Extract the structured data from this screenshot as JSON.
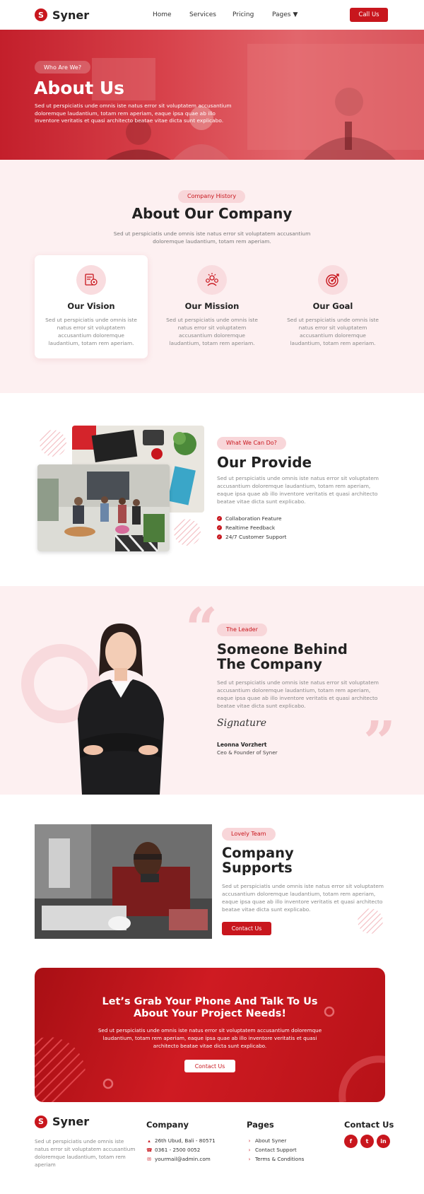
{
  "brand": {
    "name": "Syner",
    "mark": "S",
    "accent": "#c8161d"
  },
  "nav": {
    "links": [
      "Home",
      "Services",
      "Pricing",
      "Pages"
    ],
    "cta": "Call Us"
  },
  "hero": {
    "chip": "Who Are We?",
    "title": "About Us",
    "description": "Sed ut perspiciatis unde omnis iste natus error sit voluptatem accusantium doloremque laudantium, totam rem aperiam, eaque ipsa quae ab illo inventore veritatis et quasi architecto beatae vitae dicta sunt explicabo."
  },
  "about": {
    "chip": "Company History",
    "title": "About Our Company",
    "description": "Sed ut perspiciatis unde omnis iste natus error sit voluptatem accusantium doloremque laudantium, totam rem aperiam.",
    "cards": [
      {
        "title": "Our Vision",
        "icon": "vision-document-icon",
        "description": "Sed ut perspiciatis unde omnis iste natus error sit voluptatem accusantium doloremque laudantium, totam rem aperiam."
      },
      {
        "title": "Our Mission",
        "icon": "team-mission-icon",
        "description": "Sed ut perspiciatis unde omnis iste natus error sit voluptatem accusantium doloremque laudantium, totam rem aperiam."
      },
      {
        "title": "Our Goal",
        "icon": "target-goal-icon",
        "description": "Sed ut perspiciatis unde omnis iste natus error sit voluptatem accusantium doloremque laudantium, totam rem aperiam."
      }
    ]
  },
  "provide": {
    "chip": "What We Can Do?",
    "title": "Our Provide",
    "description": "Sed ut perspiciatis unde omnis iste natus error sit voluptatem accusantium doloremque laudantium, totam rem aperiam, eaque ipsa quae ab illo inventore veritatis et quasi architecto beatae vitae dicta sunt explicabo.",
    "features": [
      "Collaboration Feature",
      "Realtime Feedback",
      "24/7 Customer Support"
    ]
  },
  "leader": {
    "chip": "The Leader",
    "title_line1": "Someone Behind",
    "title_line2": "The Company",
    "description": "Sed ut perspiciatis unde omnis iste natus error sit voluptatem accusantium doloremque laudantium, totam rem aperiam, eaque ipsa quae ab illo inventore veritatis et quasi architecto beatae vitae dicta sunt explicabo.",
    "signature": "Signature",
    "name": "Leonna Vorzhert",
    "role": "Ceo & Founder of Syner"
  },
  "supports": {
    "chip": "Lovely Team",
    "title_line1": "Company",
    "title_line2": "Supports",
    "description": "Sed ut perspiciatis unde omnis iste natus error sit voluptatem accusantium doloremque laudantium, totam rem aperiam, eaque ipsa quae ab illo inventore veritatis et quasi architecto beatae vitae dicta sunt explicabo.",
    "button": "Contact Us"
  },
  "cta": {
    "title_line1": "Let’s Grab Your Phone And Talk To Us",
    "title_line2": "About Your Project Needs!",
    "description": "Sed ut perspiciatis unde omnis iste natus error sit voluptatem accusantium doloremque laudantium, totam rem aperiam, eaque ipsa quae ab illo inventore veritatis et quasi architecto beatae vitae dicta sunt explicabo.",
    "button": "Contact Us"
  },
  "footer": {
    "description": "Sed ut perspiciatis unde omnis iste natus error sit voluptatem accusantium doloremque laudantium, totam rem aperiam",
    "company_title": "Company",
    "company_items": [
      "26th Ubud, Bali - 80571",
      "0361 - 2500 0052",
      "yourmail@admin.com"
    ],
    "pages_title": "Pages",
    "pages_items": [
      "About Syner",
      "Contact Support",
      "Terms & Conditions"
    ],
    "contact_title": "Contact Us",
    "socials": [
      "facebook-icon",
      "twitter-icon",
      "linkedin-icon"
    ]
  }
}
